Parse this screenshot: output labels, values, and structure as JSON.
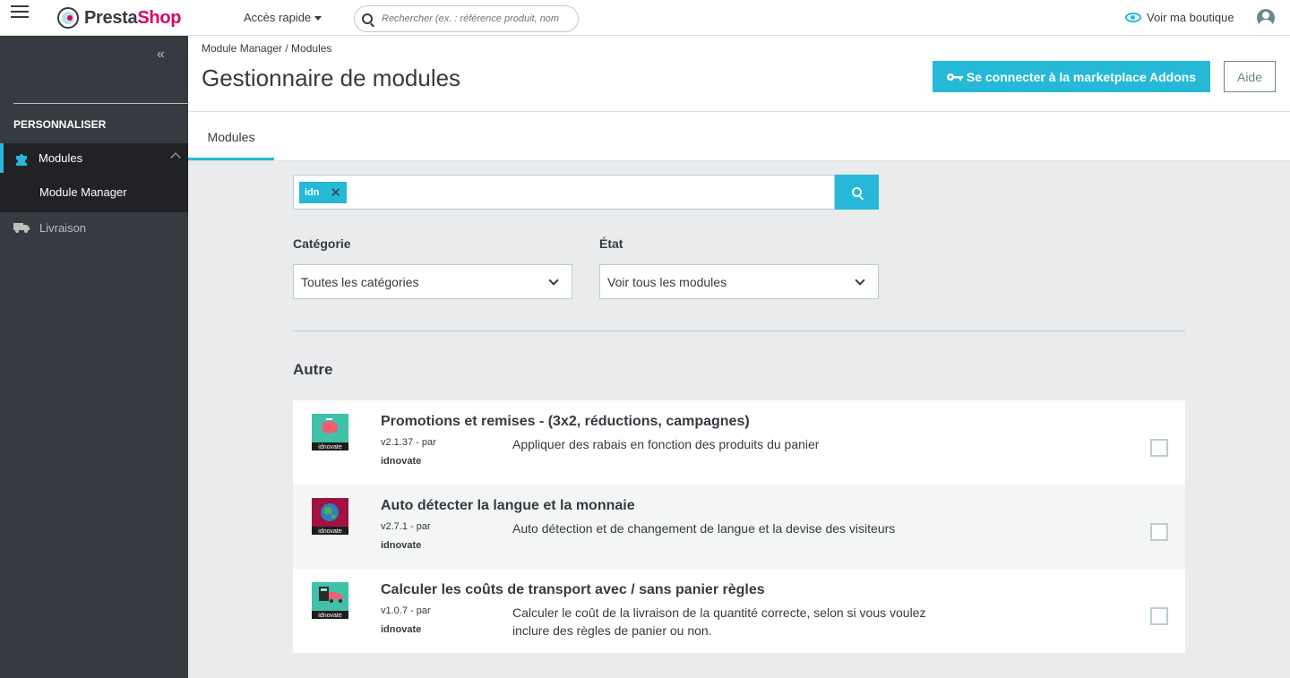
{
  "header": {
    "logo_presta": "Presta",
    "logo_shop": "Shop",
    "quick_access": "Accès rapide",
    "search_placeholder": "Rechercher (ex. : référence produit, nom",
    "view_shop": "Voir ma boutique"
  },
  "sidebar": {
    "collapse_glyph": "«",
    "section": "PERSONNALISER",
    "active_item": "Modules",
    "sub_item": "Module Manager",
    "other_item": "Livraison"
  },
  "page": {
    "breadcrumb": "Module Manager  /  Modules",
    "title": "Gestionnaire de modules",
    "addons_button": "Se connecter à la marketplace Addons",
    "help_button": "Aide"
  },
  "tabs": [
    {
      "label": "Modules"
    }
  ],
  "filter": {
    "tag": "idn",
    "tag_remove": "✕",
    "category_label": "Catégorie",
    "category_value": "Toutes les catégories",
    "state_label": "État",
    "state_value": "Voir tous les modules"
  },
  "section_title": "Autre",
  "modules": [
    {
      "name": "Promotions et remises - (3x2, réductions, campagnes)",
      "version": "v2.1.37 - par",
      "author": "idnovate",
      "description": "Appliquer des rabais en fonction des produits du panier",
      "icon_bg": "#3fc2a9",
      "icon_label": "idnovate"
    },
    {
      "name": "Auto détecter la langue et la monnaie",
      "version": "v2.7.1 - par",
      "author": "idnovate",
      "description": "Auto détection et de changement de langue et la devise des visiteurs",
      "icon_bg": "#a0123f",
      "icon_label": "idnovate"
    },
    {
      "name": "Calculer les coûts de transport avec / sans panier règles",
      "version": "v1.0.7 - par",
      "author": "idnovate",
      "description": "Calculer le coût de la livraison de la quantité correcte, selon si vous voulez inclure des règles de panier ou non.",
      "icon_bg": "#3fc2a9",
      "icon_label": "idnovate"
    }
  ],
  "colors": {
    "accent": "#25b9d7",
    "sidebar": "#363a41",
    "brand_pink": "#df0067"
  }
}
